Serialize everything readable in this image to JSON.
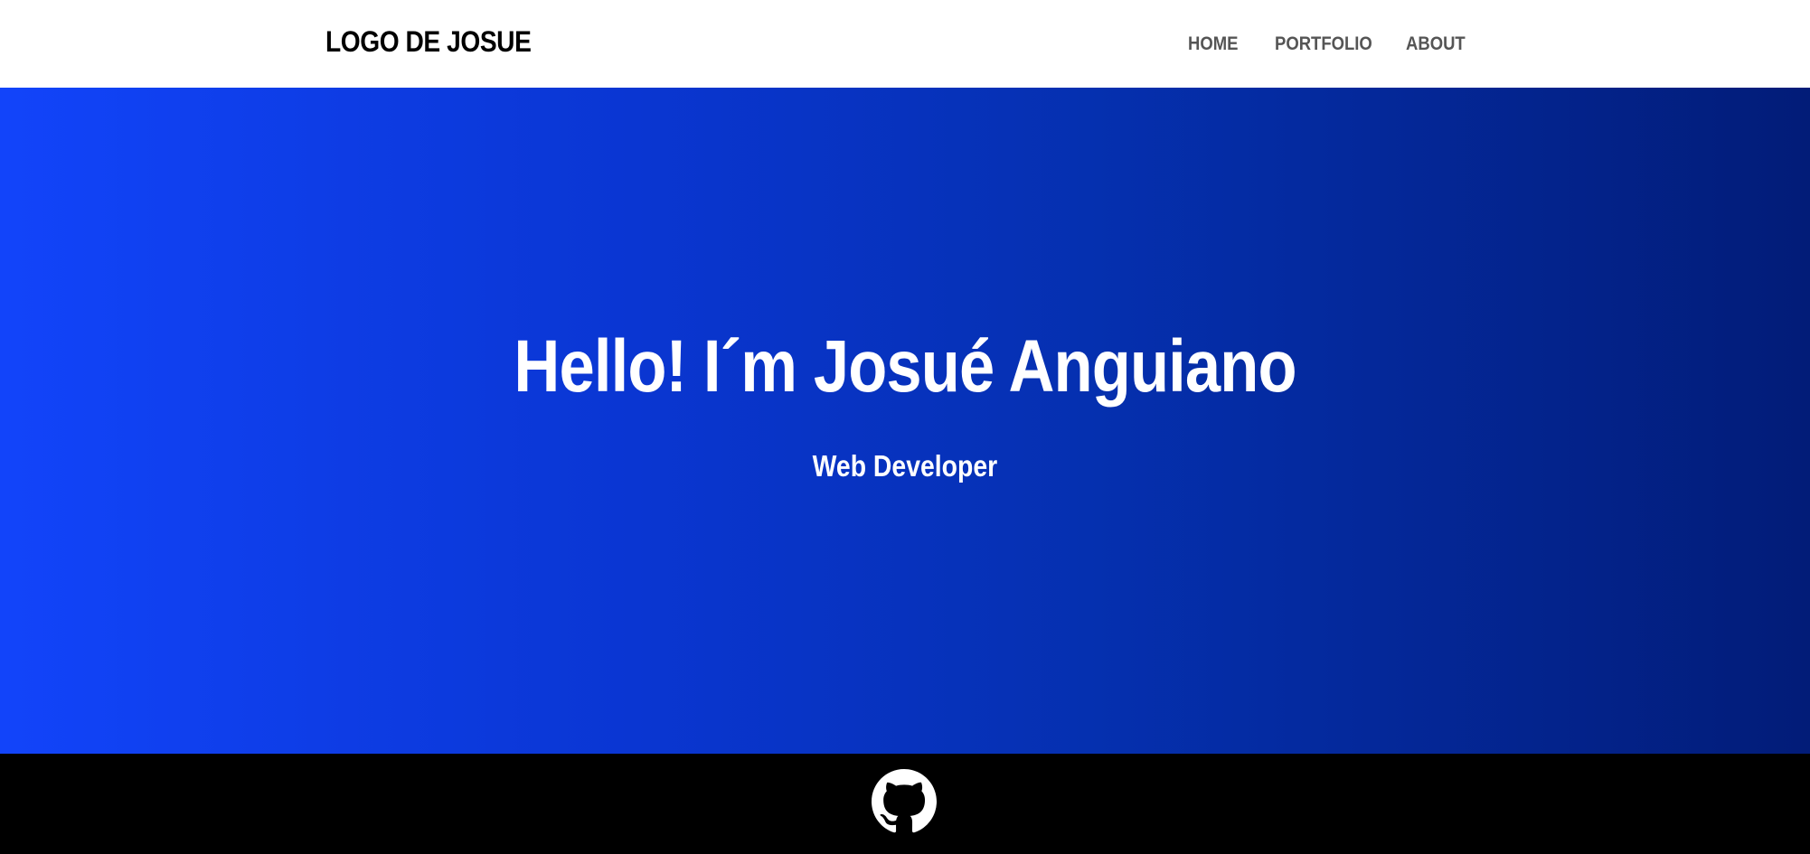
{
  "header": {
    "logo_text": "LOGO DE JOSUE",
    "nav": {
      "home": "HOME",
      "portfolio": "PORTFOLIO",
      "about": "ABOUT"
    }
  },
  "hero": {
    "title": "Hello! I´m Josué Anguiano",
    "subtitle": "Web Developer",
    "gradient_start": "#1244fa",
    "gradient_end": "#021c78"
  },
  "footer": {
    "social_icon": "github-icon",
    "background": "#000000"
  }
}
